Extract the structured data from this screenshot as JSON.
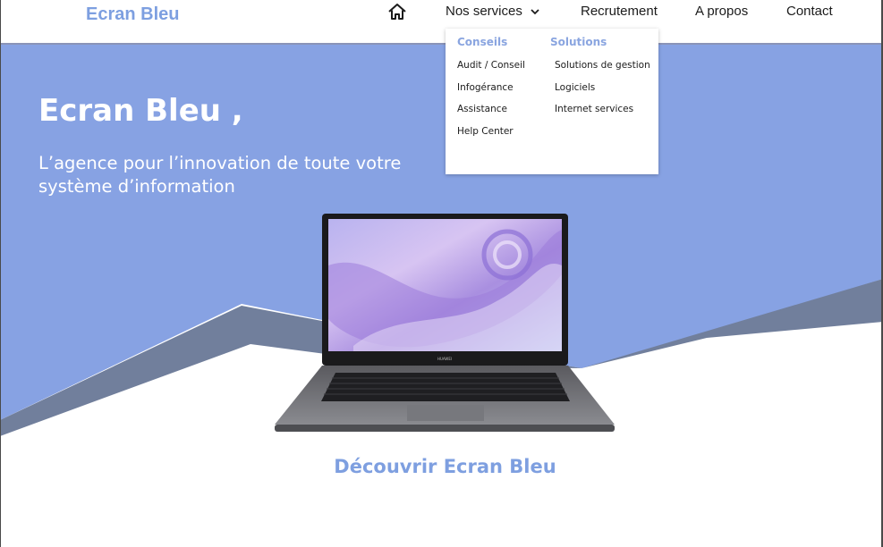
{
  "header": {
    "brand": "Ecran Bleu",
    "nav": {
      "home_icon": "home-icon",
      "services": "Nos services",
      "services_icon": "chevron-down-icon",
      "recrutement": "Recrutement",
      "apropos": "A propos",
      "contact": "Contact"
    }
  },
  "dropdown": {
    "columns": [
      {
        "title": "Conseils",
        "items": [
          "Audit / Conseil",
          "Infogérance",
          "Assistance",
          "Help Center"
        ]
      },
      {
        "title": "Solutions",
        "items": [
          "Solutions de gestion",
          "Logiciels",
          "Internet services"
        ]
      }
    ]
  },
  "hero": {
    "title": "Ecran Bleu ,",
    "subtitle": "L’agence pour l’innovation de toute votre système d’information",
    "laptop_brand": "HUAWEI"
  },
  "cta": "Découvrir Ecran Bleu",
  "colors": {
    "hero_blue": "#87a2e3",
    "wave_dark": "#717f9c",
    "brand_blue": "#7d9fe0",
    "white": "#ffffff"
  }
}
